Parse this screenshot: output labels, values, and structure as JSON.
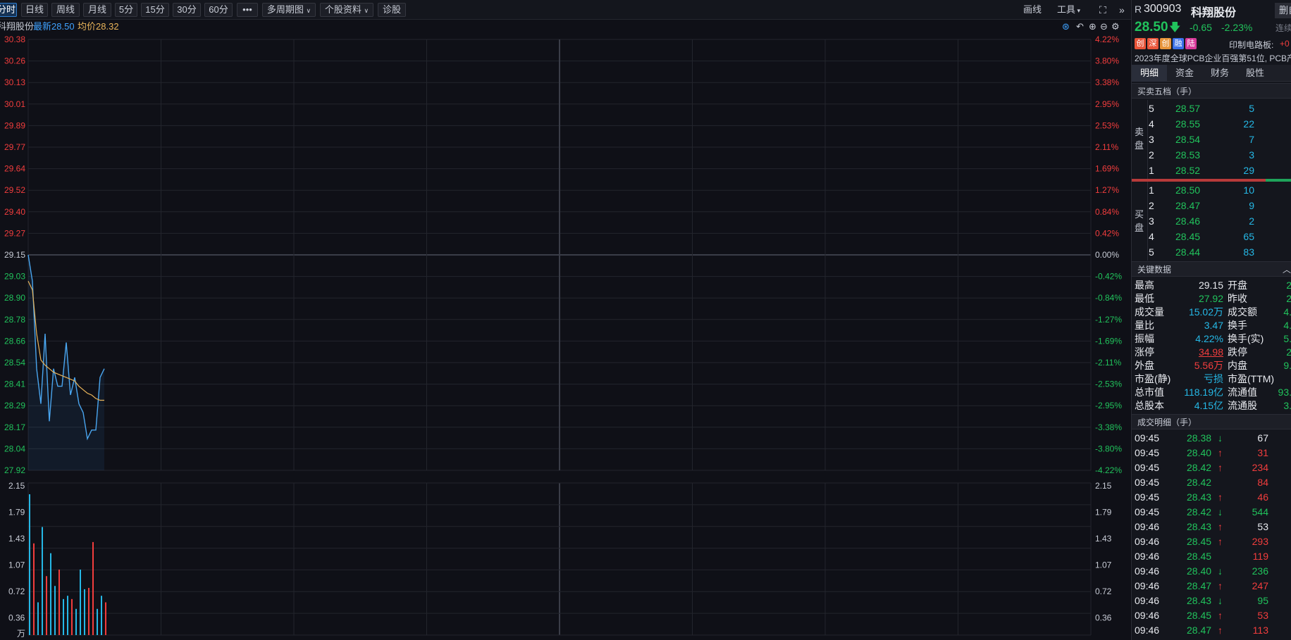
{
  "toolbar": {
    "tabs": [
      "分时",
      "日线",
      "周线",
      "月线",
      "5分",
      "15分",
      "30分",
      "60分"
    ],
    "more": "•••",
    "multi_period": "多周期图",
    "stock_info": "个股资料",
    "diagnose": "诊股",
    "draw": "画线",
    "tools": "工具",
    "right_btn": "删自"
  },
  "info": {
    "name": "科翔股份",
    "latest_label": "最新",
    "latest": "28.50",
    "avg_label": "均价",
    "avg": "28.32"
  },
  "chart_data": {
    "type": "line",
    "price_axis": [
      "30.38",
      "30.26",
      "30.13",
      "30.01",
      "29.89",
      "29.77",
      "29.64",
      "29.52",
      "29.40",
      "29.27",
      "29.15",
      "29.03",
      "28.90",
      "28.78",
      "28.66",
      "28.54",
      "28.41",
      "28.29",
      "28.17",
      "28.04",
      "27.92"
    ],
    "pct_axis": [
      "4.22%",
      "3.80%",
      "3.38%",
      "2.95%",
      "2.53%",
      "2.11%",
      "1.69%",
      "1.27%",
      "0.84%",
      "0.42%",
      "0.00%",
      "-0.42%",
      "-0.84%",
      "-1.27%",
      "-1.69%",
      "-2.11%",
      "-2.53%",
      "-2.95%",
      "-3.38%",
      "-3.80%",
      "-4.22%"
    ],
    "prev_close": 29.15,
    "ylim": [
      27.92,
      30.38
    ],
    "series": [
      {
        "values": [
          29.15,
          29.0,
          28.5,
          28.3,
          28.7,
          28.2,
          28.5,
          28.4,
          28.4,
          28.65,
          28.35,
          28.45,
          28.3,
          28.25,
          28.1,
          28.15,
          28.15,
          28.45,
          28.5
        ]
      },
      {
        "values": [
          29.0,
          28.95,
          28.7,
          28.55,
          28.52,
          28.5,
          28.48,
          28.47,
          28.46,
          28.45,
          28.44,
          28.43,
          28.4,
          28.38,
          28.36,
          28.35,
          28.33,
          28.32,
          28.32
        ]
      }
    ],
    "volume_axis": [
      "2.15",
      "1.79",
      "1.43",
      "1.07",
      "0.72",
      "0.36"
    ],
    "volume_unit": "万",
    "volume_max": 2.15,
    "volumes": [
      2.15,
      1.4,
      0.5,
      1.65,
      0.9,
      1.25,
      0.75,
      1.0,
      0.55,
      0.6,
      0.55,
      0.4,
      1.0,
      0.7,
      0.72,
      1.42,
      0.4,
      0.6,
      0.5
    ],
    "volume_up": [
      false,
      true,
      false,
      false,
      true,
      false,
      false,
      true,
      false,
      false,
      true,
      false,
      false,
      false,
      true,
      true,
      false,
      false,
      true
    ]
  },
  "quote": {
    "prefix": "R",
    "code": "300903",
    "name": "科翔股份",
    "price": "28.50",
    "change": "-0.65",
    "change_pct": "-2.23%",
    "right_hint": "连续",
    "badges": [
      {
        "t": "创",
        "color": "#e8553a"
      },
      {
        "t": "深",
        "color": "#e8553a"
      },
      {
        "t": "创",
        "color": "#e8943a"
      },
      {
        "t": "融",
        "color": "#3a6fe8"
      },
      {
        "t": "陆",
        "color": "#d83a9a"
      }
    ],
    "sector": "印制电路板:",
    "sector_val": "+0",
    "desc": "2023年度全球PCB企业百强第51位, PCB产"
  },
  "tabs": [
    "明细",
    "资金",
    "财务",
    "股性"
  ],
  "orderbook": {
    "title": "买卖五档（手）",
    "sell_label": [
      "卖",
      "盘"
    ],
    "buy_label": [
      "买",
      "盘"
    ],
    "sells": [
      {
        "lvl": "5",
        "price": "28.57",
        "vol": "5"
      },
      {
        "lvl": "4",
        "price": "28.55",
        "vol": "22"
      },
      {
        "lvl": "3",
        "price": "28.54",
        "vol": "7"
      },
      {
        "lvl": "2",
        "price": "28.53",
        "vol": "3"
      },
      {
        "lvl": "1",
        "price": "28.52",
        "vol": "29"
      }
    ],
    "buys": [
      {
        "lvl": "1",
        "price": "28.50",
        "vol": "10"
      },
      {
        "lvl": "2",
        "price": "28.47",
        "vol": "9"
      },
      {
        "lvl": "3",
        "price": "28.46",
        "vol": "2"
      },
      {
        "lvl": "4",
        "price": "28.45",
        "vol": "65"
      },
      {
        "lvl": "5",
        "price": "28.44",
        "vol": "83"
      }
    ]
  },
  "key_data": {
    "title": "关键数据",
    "left": [
      {
        "k": "最高",
        "v": "29.15",
        "c": "w"
      },
      {
        "k": "最低",
        "v": "27.92",
        "c": "g"
      },
      {
        "k": "成交量",
        "v": "15.02万",
        "c": "c"
      },
      {
        "k": "量比",
        "v": "3.47",
        "c": "c"
      },
      {
        "k": "振幅",
        "v": "4.22%",
        "c": "c"
      },
      {
        "k": "涨停",
        "v": "34.98",
        "c": "r"
      },
      {
        "k": "外盘",
        "v": "5.56万",
        "c": "r"
      },
      {
        "k": "市盈(静)",
        "v": "亏损",
        "c": "c"
      },
      {
        "k": "总市值",
        "v": "118.19亿",
        "c": "c"
      },
      {
        "k": "总股本",
        "v": "4.15亿",
        "c": "c"
      }
    ],
    "right": [
      {
        "k": "开盘",
        "v": "2"
      },
      {
        "k": "昨收",
        "v": "2"
      },
      {
        "k": "成交额",
        "v": "4."
      },
      {
        "k": "换手",
        "v": "4."
      },
      {
        "k": "换手(实)",
        "v": "5."
      },
      {
        "k": "跌停",
        "v": "2"
      },
      {
        "k": "内盘",
        "v": "9."
      },
      {
        "k": "市盈(TTM)",
        "v": ""
      },
      {
        "k": "流通值",
        "v": "93."
      },
      {
        "k": "流通股",
        "v": "3."
      }
    ]
  },
  "trades": {
    "title": "成交明细（手）",
    "rows": [
      {
        "t": "09:45",
        "p": "28.38",
        "d": "down",
        "v": "67",
        "vc": "w"
      },
      {
        "t": "09:45",
        "p": "28.40",
        "d": "up",
        "v": "31",
        "vc": "r"
      },
      {
        "t": "09:45",
        "p": "28.42",
        "d": "up",
        "v": "234",
        "vc": "r"
      },
      {
        "t": "09:45",
        "p": "28.42",
        "d": "",
        "v": "84",
        "vc": "r"
      },
      {
        "t": "09:45",
        "p": "28.43",
        "d": "up",
        "v": "46",
        "vc": "r"
      },
      {
        "t": "09:45",
        "p": "28.42",
        "d": "down",
        "v": "544",
        "vc": "g"
      },
      {
        "t": "09:46",
        "p": "28.43",
        "d": "up",
        "v": "53",
        "vc": "w"
      },
      {
        "t": "09:46",
        "p": "28.45",
        "d": "up",
        "v": "293",
        "vc": "r"
      },
      {
        "t": "09:46",
        "p": "28.45",
        "d": "",
        "v": "119",
        "vc": "r"
      },
      {
        "t": "09:46",
        "p": "28.40",
        "d": "down",
        "v": "236",
        "vc": "g"
      },
      {
        "t": "09:46",
        "p": "28.47",
        "d": "up",
        "v": "247",
        "vc": "r"
      },
      {
        "t": "09:46",
        "p": "28.43",
        "d": "down",
        "v": "95",
        "vc": "g"
      },
      {
        "t": "09:46",
        "p": "28.45",
        "d": "up",
        "v": "53",
        "vc": "r"
      },
      {
        "t": "09:46",
        "p": "28.47",
        "d": "up",
        "v": "113",
        "vc": "r"
      }
    ]
  }
}
